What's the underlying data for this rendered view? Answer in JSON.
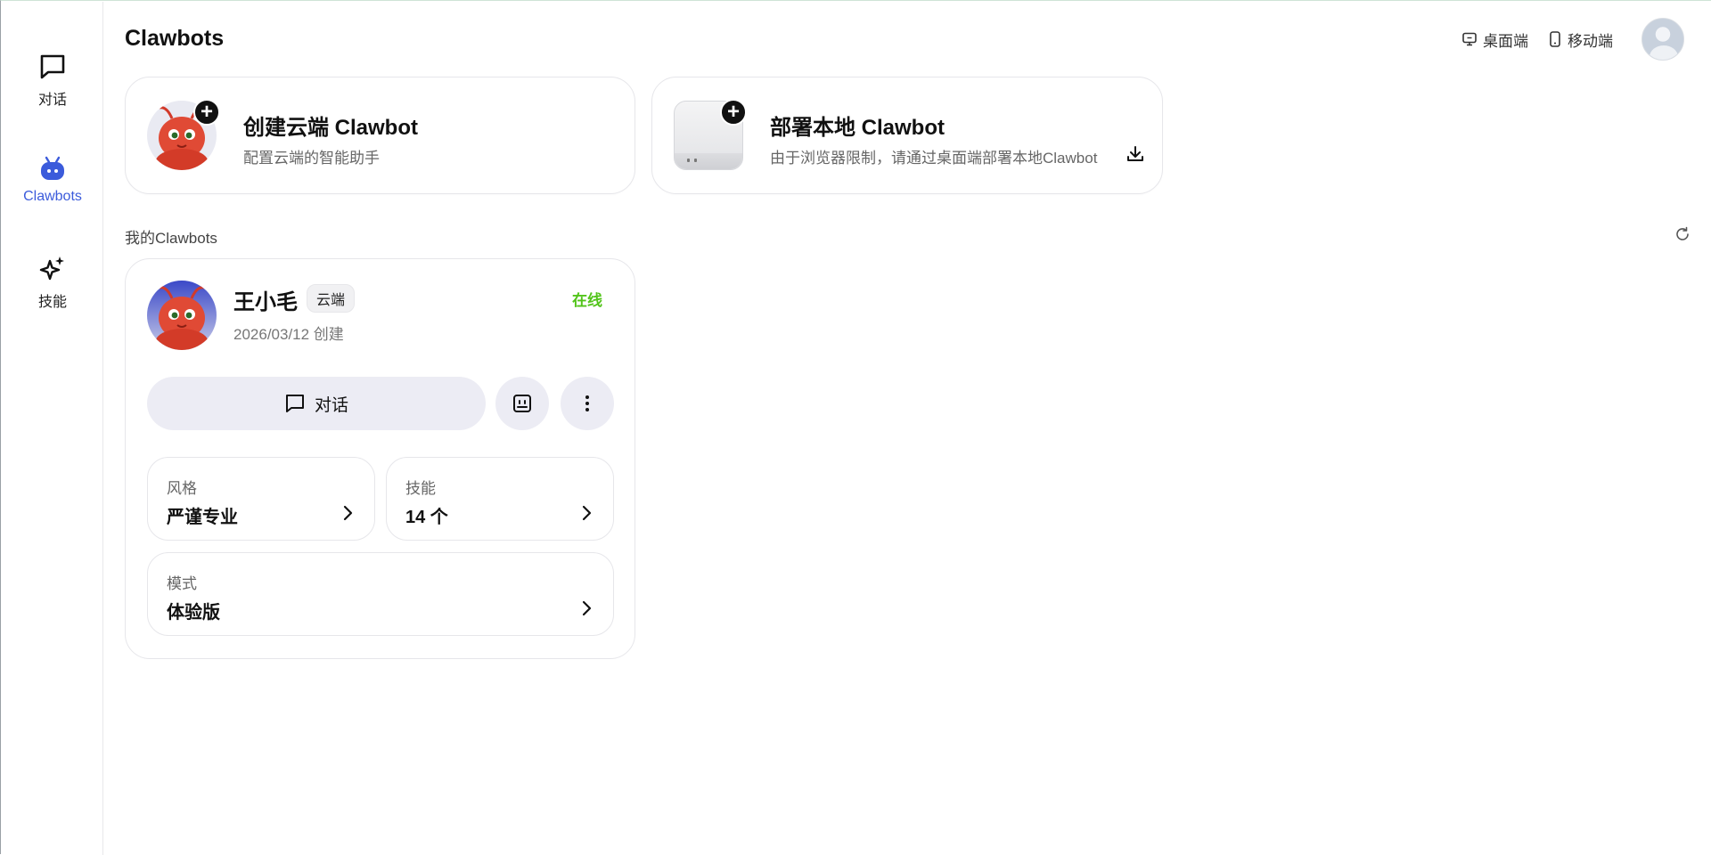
{
  "sidebar": {
    "items": [
      {
        "label": "对话",
        "icon": "chat-bubble-icon",
        "active": false
      },
      {
        "label": "Clawbots",
        "icon": "robot-icon",
        "active": true
      },
      {
        "label": "技能",
        "icon": "sparkle-icon",
        "active": false
      }
    ]
  },
  "header": {
    "title": "Clawbots",
    "desktop_label": "桌面端",
    "mobile_label": "移动端"
  },
  "create_cloud": {
    "title": "创建云端 Clawbot",
    "subtitle": "配置云端的智能助手"
  },
  "deploy_local": {
    "title": "部署本地 Clawbot",
    "subtitle": "由于浏览器限制，请通过桌面端部署本地Clawbot"
  },
  "my_bots": {
    "section_label": "我的Clawbots"
  },
  "bot": {
    "name": "王小毛",
    "tag": "云端",
    "created": "2026/03/12 创建",
    "status": "在线",
    "chat_label": "对话",
    "style_label": "风格",
    "style_value": "严谨专业",
    "skills_label": "技能",
    "skills_value": "14 个",
    "mode_label": "模式",
    "mode_value": "体验版"
  },
  "colors": {
    "accent": "#3b5bdb",
    "online": "#52c41a",
    "button_bg": "#ececf4"
  }
}
